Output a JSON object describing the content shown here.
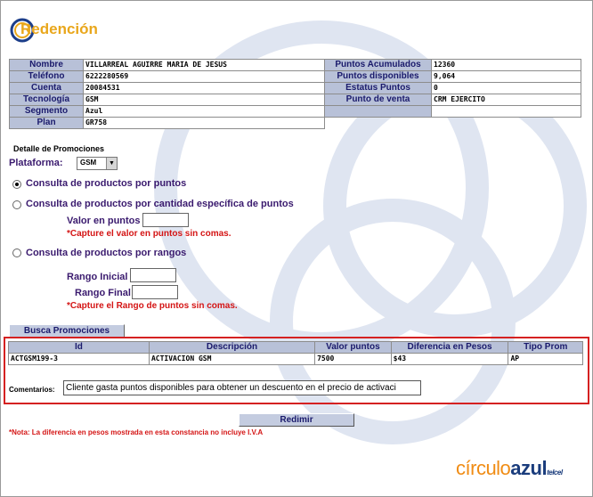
{
  "header": {
    "title": "Redención"
  },
  "client": {
    "left": [
      {
        "label": "Nombre",
        "value": "VILLARREAL AGUIRRE MARIA DE JESUS"
      },
      {
        "label": "Teléfono",
        "value": "6222280569"
      },
      {
        "label": "Cuenta",
        "value": "20084531"
      },
      {
        "label": "Tecnología",
        "value": "GSM"
      },
      {
        "label": "Segmento",
        "value": "Azul"
      },
      {
        "label": "Plan",
        "value": "GR758"
      }
    ],
    "right": [
      {
        "label": "Puntos Acumulados",
        "value": "12360"
      },
      {
        "label": "Puntos disponibles",
        "value": "9,064"
      },
      {
        "label": "Estatus Puntos",
        "value": "0"
      },
      {
        "label": "Punto de venta",
        "value": "CRM EJERCITO"
      }
    ]
  },
  "promotions": {
    "section_title": "Detalle de Promociones",
    "platform_label": "Plataforma:",
    "platform_value": "GSM",
    "options": {
      "by_points": "Consulta de productos por puntos",
      "by_quantity": "Consulta de productos por cantidad específica de puntos",
      "by_range": "Consulta de productos por rangos"
    },
    "selected_option": "by_points",
    "points_value_label": "Valor en puntos",
    "points_warning": "*Capture el valor en puntos sin comas.",
    "range_start_label": "Rango Inicial",
    "range_end_label": "Rango Final",
    "range_warning": "*Capture el Rango de puntos sin comas.",
    "search_button": "Busca Promociones"
  },
  "results": {
    "headers": [
      "Id",
      "Descripción",
      "Valor puntos",
      "Diferencia en Pesos",
      "Tipo Prom"
    ],
    "rows": [
      [
        "ACTGSM199-3",
        "ACTIVACION GSM",
        "7500",
        "$43",
        "AP"
      ]
    ],
    "comments_label": "Comentarios:",
    "comments_value": "Cliente gasta puntos disponibles para obtener un descuento en el precio de activaci"
  },
  "actions": {
    "redeem_button": "Redimir"
  },
  "footer": {
    "note": "*Nota: La diferencia en pesos mostrada en esta constancia no incluye I.V.A",
    "brand_part1": "círculo",
    "brand_part2": "azul",
    "brand_part3": "telcel"
  },
  "colors": {
    "accent": "#e9a71c",
    "label_bg": "#b8c1d8",
    "label_text": "#1a1a6c",
    "warning": "#d41414",
    "highlight_border": "#d52121"
  }
}
